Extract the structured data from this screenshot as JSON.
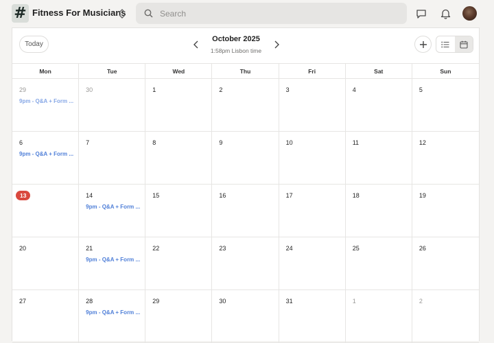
{
  "header": {
    "group_name": "Fitness For Musicians",
    "logo_glyph": "#",
    "search_placeholder": "Search",
    "icons": [
      "hashtag-logo-icon",
      "chevron-updown-icon",
      "search-icon",
      "chat-icon",
      "bell-icon",
      "avatar"
    ]
  },
  "toolbar": {
    "today_label": "Today",
    "month_title": "October 2025",
    "timezone_note": "1:58pm Lisbon time",
    "add_icon": "plus-icon",
    "view_list_icon": "list-icon",
    "view_calendar_icon": "calendar-icon",
    "active_view": "calendar"
  },
  "calendar": {
    "weekdays": [
      "Mon",
      "Tue",
      "Wed",
      "Thu",
      "Fri",
      "Sat",
      "Sun"
    ],
    "today": "13",
    "accent_color": "#d9483e",
    "event_color": "#4f7fd8",
    "weeks": [
      {
        "days": [
          {
            "num": "29",
            "muted": true,
            "event": "9pm - Q&A + Form ..."
          },
          {
            "num": "30",
            "muted": true
          },
          {
            "num": "1"
          },
          {
            "num": "2"
          },
          {
            "num": "3"
          },
          {
            "num": "4"
          },
          {
            "num": "5"
          }
        ]
      },
      {
        "days": [
          {
            "num": "6",
            "event": "9pm - Q&A + Form ..."
          },
          {
            "num": "7"
          },
          {
            "num": "8"
          },
          {
            "num": "9"
          },
          {
            "num": "10"
          },
          {
            "num": "11"
          },
          {
            "num": "12"
          }
        ]
      },
      {
        "days": [
          {
            "num": "13",
            "today": true
          },
          {
            "num": "14",
            "event": "9pm - Q&A + Form ..."
          },
          {
            "num": "15"
          },
          {
            "num": "16"
          },
          {
            "num": "17"
          },
          {
            "num": "18"
          },
          {
            "num": "19"
          }
        ]
      },
      {
        "days": [
          {
            "num": "20"
          },
          {
            "num": "21",
            "event": "9pm - Q&A + Form ..."
          },
          {
            "num": "22"
          },
          {
            "num": "23"
          },
          {
            "num": "24"
          },
          {
            "num": "25"
          },
          {
            "num": "26"
          }
        ]
      },
      {
        "days": [
          {
            "num": "27"
          },
          {
            "num": "28",
            "event": "9pm - Q&A + Form ..."
          },
          {
            "num": "29"
          },
          {
            "num": "30"
          },
          {
            "num": "31"
          },
          {
            "num": "1",
            "muted": true
          },
          {
            "num": "2",
            "muted": true
          }
        ]
      }
    ]
  }
}
